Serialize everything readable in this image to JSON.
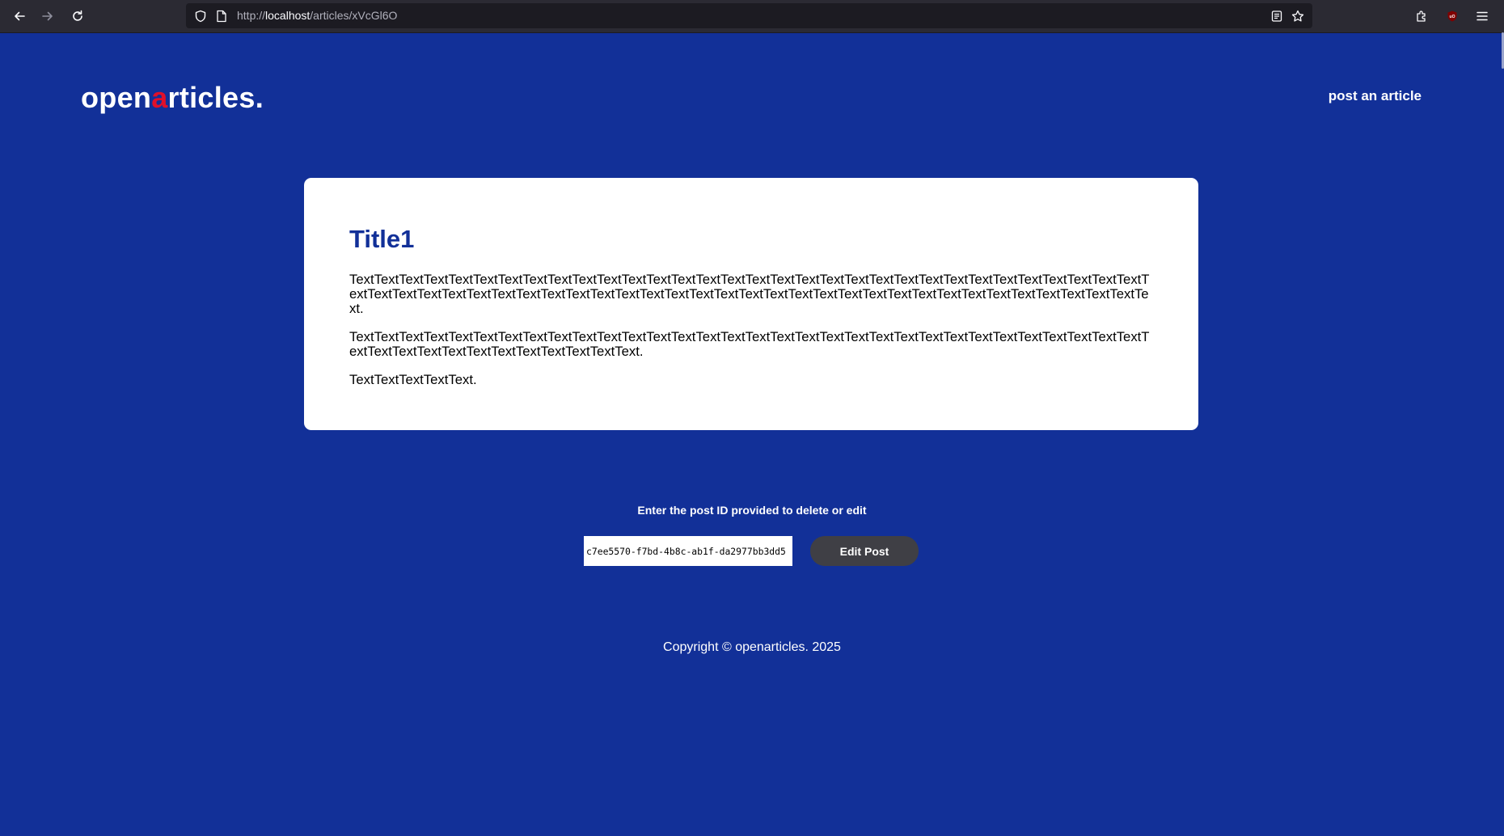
{
  "browser": {
    "back_icon": "arrow-left-icon",
    "forward_icon": "arrow-right-icon",
    "reload_icon": "reload-icon",
    "url_scheme": "http://",
    "url_host": "localhost",
    "url_path": "/articles/xVcGl6O",
    "reader_icon": "reader-view-icon",
    "bookmark_icon": "star-icon",
    "extensions_icon": "puzzle-icon",
    "ublock_icon": "ublock-shield-icon",
    "menu_icon": "hamburger-menu-icon"
  },
  "site": {
    "logo_before": "open",
    "logo_accent": "a",
    "logo_after": "rticles.",
    "nav_post_label": "post an article"
  },
  "article": {
    "title": "Title1",
    "paragraphs": [
      "TextTextTextTextTextTextTextTextTextTextTextTextTextTextTextTextTextTextTextTextTextTextTextTextTextTextTextTextTextTextTextTextTextTextTextTextTextTextTextTextTextTextTextTextTextTextTextTextTextTextTextTextTextTextTextTextTextTextTextTextTextTextTextTextText.",
      "TextTextTextTextTextTextTextTextTextTextTextTextTextTextTextTextTextTextTextTextTextTextTextTextTextTextTextTextTextTextTextTextTextTextTextTextTextTextTextTextTextTextTextText.",
      "TextTextTextTextText."
    ]
  },
  "post_form": {
    "prompt": "Enter the post ID provided to delete or edit",
    "post_id_value": "c7ee5570-f7bd-4b8c-ab1f-da2977bb3dd5",
    "edit_label": "Edit Post"
  },
  "footer": {
    "copyright": "Copyright © openarticles. 2025"
  },
  "colors": {
    "page_bg": "#123098",
    "title": "#123098",
    "logo_accent": "#e0102a",
    "button_bg": "#3f3f45",
    "chrome_bg": "#2b2a33"
  }
}
